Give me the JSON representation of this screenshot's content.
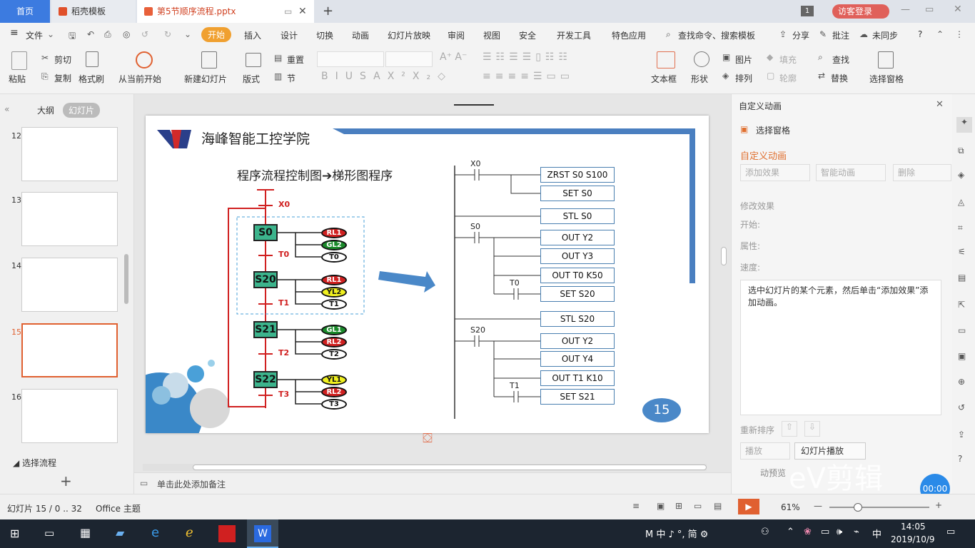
{
  "tabs": {
    "home": "首页",
    "daoke": "稻壳模板",
    "file": "第5节顺序流程.pptx",
    "add": "+"
  },
  "titlebar": {
    "count": "1",
    "login": "访客登录"
  },
  "menu": {
    "hamburger": "≡",
    "file": "文件",
    "items": [
      "开始",
      "插入",
      "设计",
      "切换",
      "动画",
      "幻灯片放映",
      "审阅",
      "视图",
      "安全",
      "开发工具",
      "特色应用"
    ],
    "search": "查找命令、搜索模板",
    "share": "分享",
    "annotate": "批注",
    "sync": "未同步",
    "help": "?"
  },
  "ribbon": {
    "paste": "粘贴",
    "cut": "剪切",
    "copy": "复制",
    "format_painter": "格式刷",
    "from_start": "从当前开始",
    "new_slide": "新建幻灯片",
    "layout": "版式",
    "reset": "重置",
    "section": "节",
    "textbox": "文本框",
    "shape": "形状",
    "picture": "图片",
    "fill": "填充",
    "arrange": "排列",
    "outline": "轮廓",
    "find": "查找",
    "replace": "替换",
    "select_pane": "选择窗格"
  },
  "leftpanel": {
    "outline_tab": "大纲",
    "slides_tab": "幻灯片",
    "thumbs": [
      "12",
      "13",
      "14",
      "15",
      "16"
    ],
    "section": "选择流程",
    "add": "+"
  },
  "slide": {
    "school": "海峰智能工控学院",
    "subtitle_a": "程序流程控制图",
    "subtitle_arrow": "➔",
    "subtitle_b": "梯形图程序",
    "page": "15",
    "sfc": {
      "steps": [
        "S0",
        "S20",
        "S21",
        "S22"
      ],
      "conditions": [
        "X0",
        "T0",
        "T1",
        "T2",
        "T3"
      ],
      "outputs": [
        [
          "RL1",
          "GL2",
          "T0"
        ],
        [
          "RL1",
          "YL2",
          "T1"
        ],
        [
          "GL1",
          "RL2",
          "T2"
        ],
        [
          "YL1",
          "RL2",
          "T3"
        ]
      ]
    },
    "ladder": {
      "contacts": [
        "X0",
        "S0",
        "T0",
        "S20",
        "T1"
      ],
      "coils": [
        "ZRST S0 S100",
        "SET S0",
        "STL S0",
        "OUT Y2",
        "OUT Y3",
        "OUT T0 K50",
        "SET S20",
        "STL S20",
        "OUT Y2",
        "OUT Y4",
        "OUT T1 K10",
        "SET S21"
      ]
    }
  },
  "notes": "单击此处添加备注",
  "rightpane": {
    "title": "自定义动画",
    "select_pane": "选择窗格",
    "section": "自定义动画",
    "add_effect": "添加效果",
    "smart_anim": "智能动画",
    "delete": "删除",
    "modify": "修改效果",
    "start": "开始:",
    "property": "属性:",
    "speed": "速度:",
    "hint": "选中幻灯片的某个元素，然后单击“添加效果”添加动画。",
    "reorder": "重新排序",
    "play": "播放",
    "slideshow": "幻灯片播放",
    "autopreview": "动预览",
    "watermark": "eV剪辑",
    "timer": "00:00"
  },
  "status": {
    "slide": "幻灯片 15 / 0 .. 32",
    "theme": "Office 主题",
    "zoom": "61%"
  },
  "taskbar": {
    "ime": "M 中 ♪ °, 简 ⚙",
    "ime2": "中",
    "time": "14:05",
    "date": "2019/10/9"
  },
  "colors": {
    "accent": "#3c7be0",
    "orange": "#f0a030",
    "step_fill": "#3cb48c",
    "red": "#d02020",
    "green": "#1a8a2a",
    "yellow": "#f0f020",
    "ladder_border": "#4a7fb0"
  }
}
